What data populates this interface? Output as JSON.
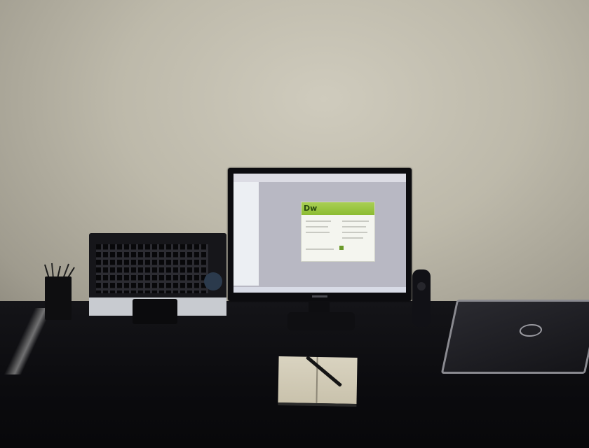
{
  "scene": {
    "objects": [
      "wall",
      "desk",
      "monitor",
      "keyboard",
      "pen-cup",
      "speaker",
      "laptop",
      "notebook",
      "pen"
    ]
  },
  "colors": {
    "wall": "#bdb9aa",
    "desk": "#0b0b0e",
    "screen": "#b8b8c3",
    "dialog_accent": "#8cbc32"
  },
  "monitor": {
    "screen_app_logo": "Dw"
  }
}
